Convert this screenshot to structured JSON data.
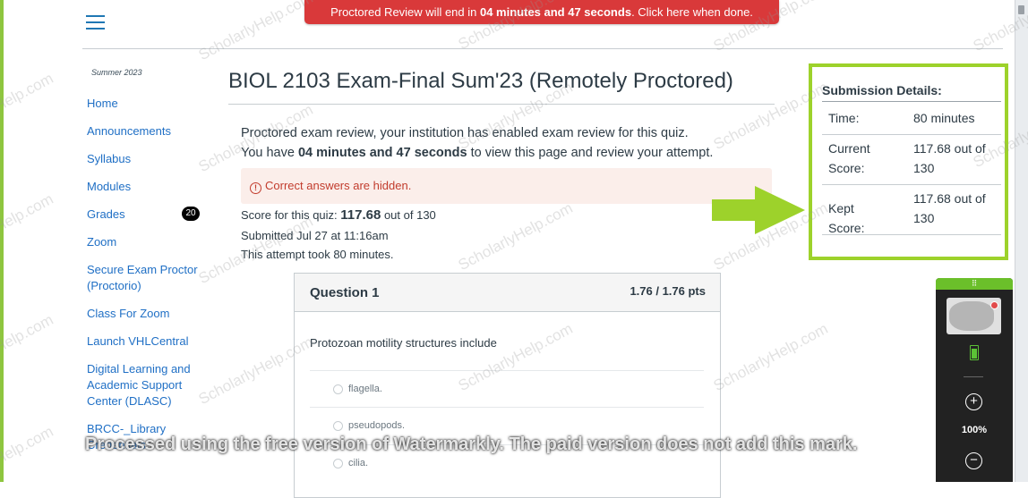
{
  "banner": {
    "prefix": "Proctored Review will end in ",
    "time": "04 minutes and 47 seconds",
    "suffix": ". Click here when done."
  },
  "course": {
    "term": "Summer 2023"
  },
  "nav": {
    "items": [
      {
        "label": "Home"
      },
      {
        "label": "Announcements"
      },
      {
        "label": "Syllabus"
      },
      {
        "label": "Modules"
      },
      {
        "label": "Grades",
        "badge": "20"
      },
      {
        "label": "Zoom"
      },
      {
        "label": "Secure Exam Proctor (Proctorio)"
      },
      {
        "label": "Class For Zoom"
      },
      {
        "label": "Launch VHLCentral"
      },
      {
        "label": "Digital Learning and Academic Support Center (DLASC)"
      },
      {
        "label": "BRCC-_Library"
      },
      {
        "label": "Credentials"
      }
    ]
  },
  "quiz": {
    "title": "BIOL 2103 Exam-Final Sum'23 (Remotely Proctored)",
    "intro_line1": "Proctored exam review, your institution has enabled exam review for this quiz.",
    "intro_prefix": "You have ",
    "intro_time": "04 minutes and 47 seconds",
    "intro_suffix": " to view this page and review your attempt.",
    "alert": "Correct answers are hidden.",
    "score_label": "Score for this quiz: ",
    "score_value": "117.68",
    "score_suffix": " out of 130",
    "submitted": "Submitted Jul 27 at 11:16am",
    "attempt": "This attempt took 80 minutes."
  },
  "question": {
    "title": "Question 1",
    "points": "1.76 / 1.76 pts",
    "text": "Protozoan motility structures include",
    "answers": [
      "flagella.",
      "pseudopods.",
      "cilia."
    ]
  },
  "submission": {
    "title": "Submission Details:",
    "time_label": "Time:",
    "time_value": "80 minutes",
    "current_label": "Current Score:",
    "current_value": "117.68 out of 130",
    "kept_label": "Kept Score:",
    "kept_value": "117.68 out of 130"
  },
  "proctor": {
    "zoom": "100%"
  },
  "watermark": {
    "site": "ScholarlyHelp.com",
    "notice": "Processed using the free version of Watermarkly. The paid version does not add this mark."
  },
  "colors": {
    "banner": "#d9393a",
    "link": "#1f6fc5",
    "highlight": "#9dd22b",
    "alert_text": "#c23c2d"
  }
}
